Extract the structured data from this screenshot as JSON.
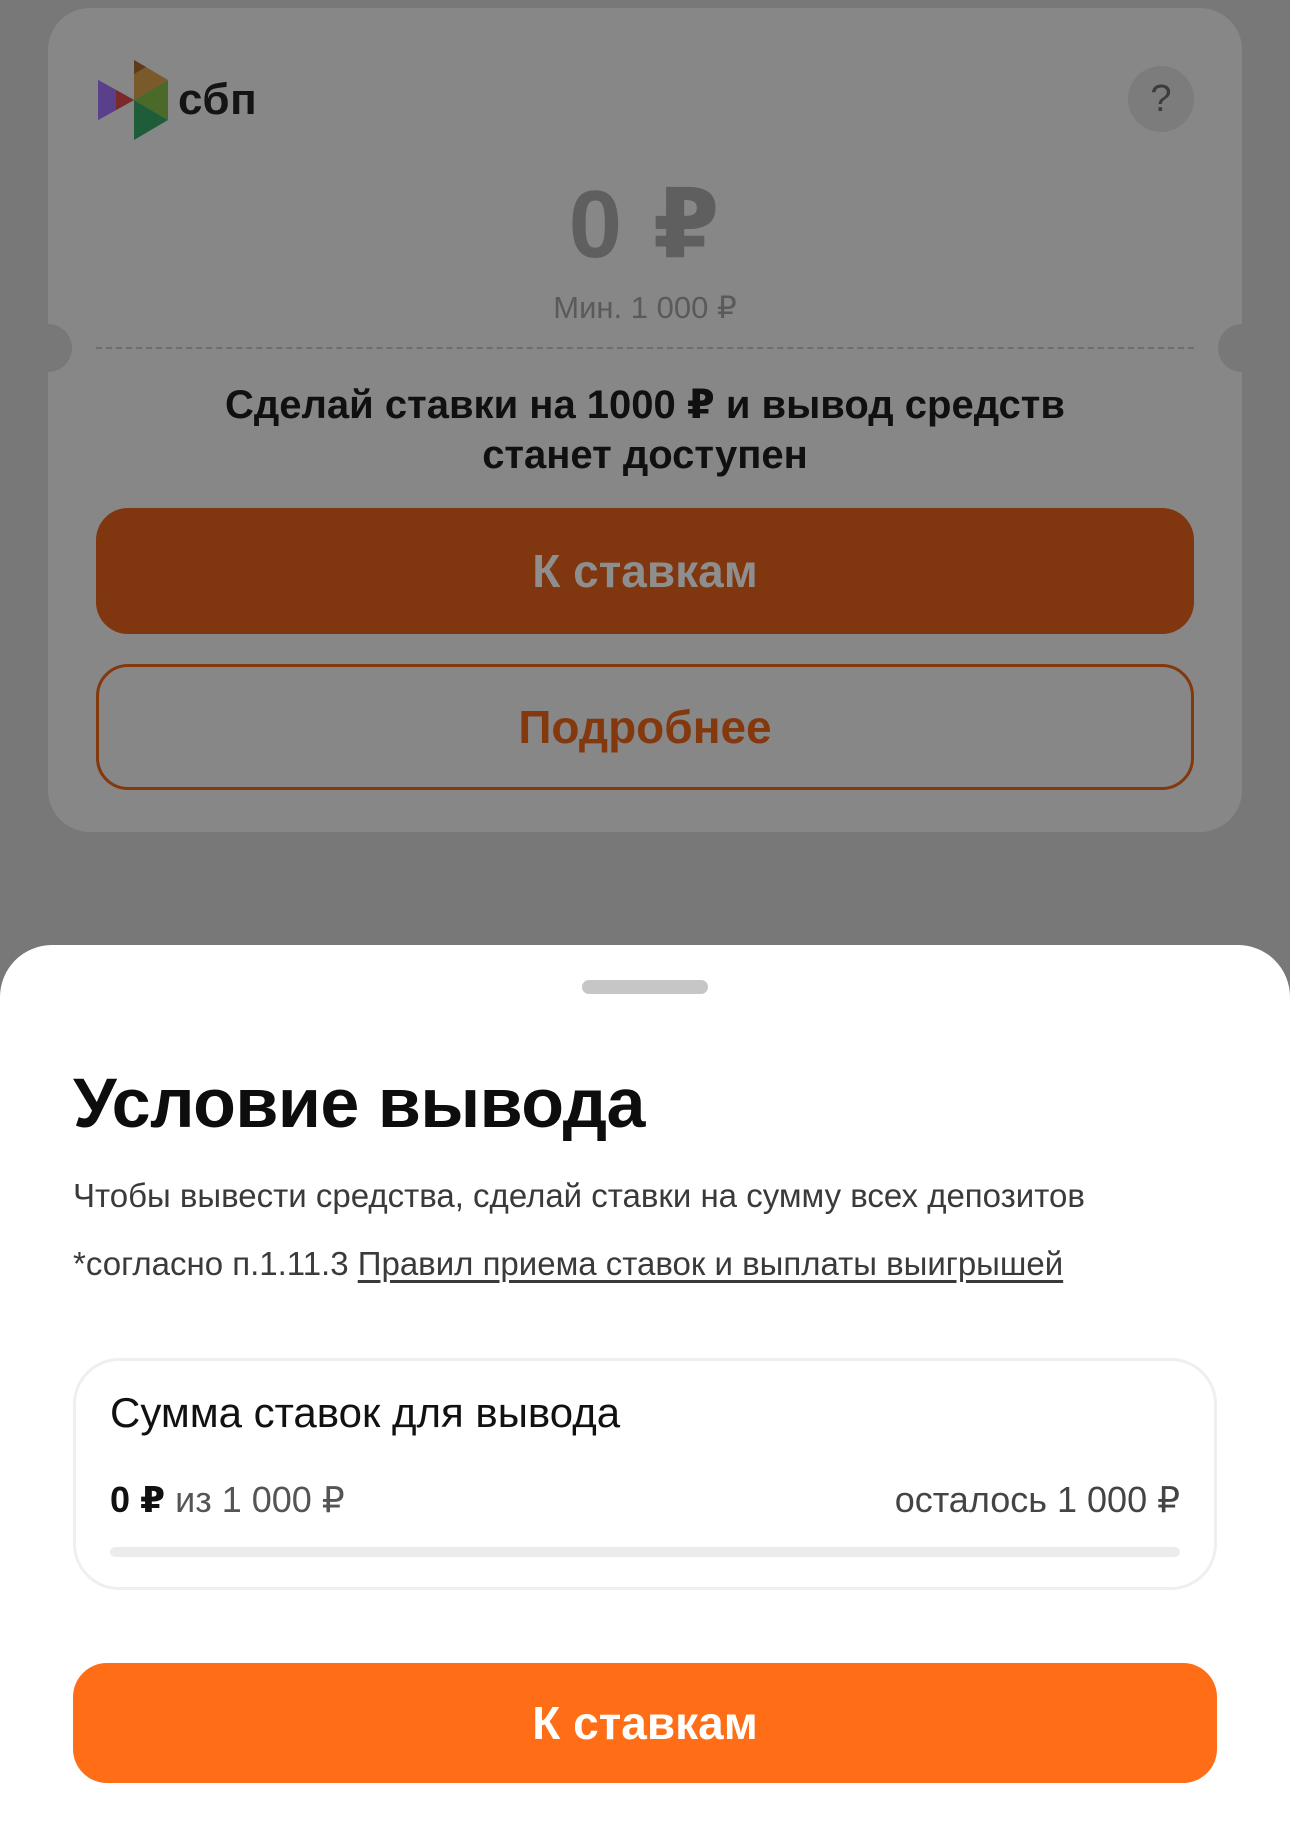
{
  "background": {
    "logo_text": "сбп",
    "help_label": "?",
    "amount": "0 ₽",
    "min_label": "Мин. 1 000 ₽",
    "info_line1": "Сделай ставки на 1000 ₽ и вывод средств",
    "info_line2": "станет доступен",
    "primary_button": "К ставкам",
    "secondary_button": "Подробнее"
  },
  "sheet": {
    "title": "Условие вывода",
    "description": "Чтобы вывести средства, сделай ставки на сумму всех депозитов",
    "rule_prefix": "*согласно п.1.11.3 ",
    "rule_link": "Правил приема ставок и выплаты выигрышей",
    "progress": {
      "title": "Сумма ставок для вывода",
      "current": "0 ₽",
      "of_text": " из 1 000 ₽",
      "remaining": "осталось 1 000 ₽",
      "fraction": 0
    },
    "main_button": "К ставкам"
  },
  "colors": {
    "accent": "#ff6d17",
    "accent_dimmed": "#80360e"
  },
  "icons": {
    "logo": "sbp-logo-icon",
    "help": "question-icon"
  }
}
